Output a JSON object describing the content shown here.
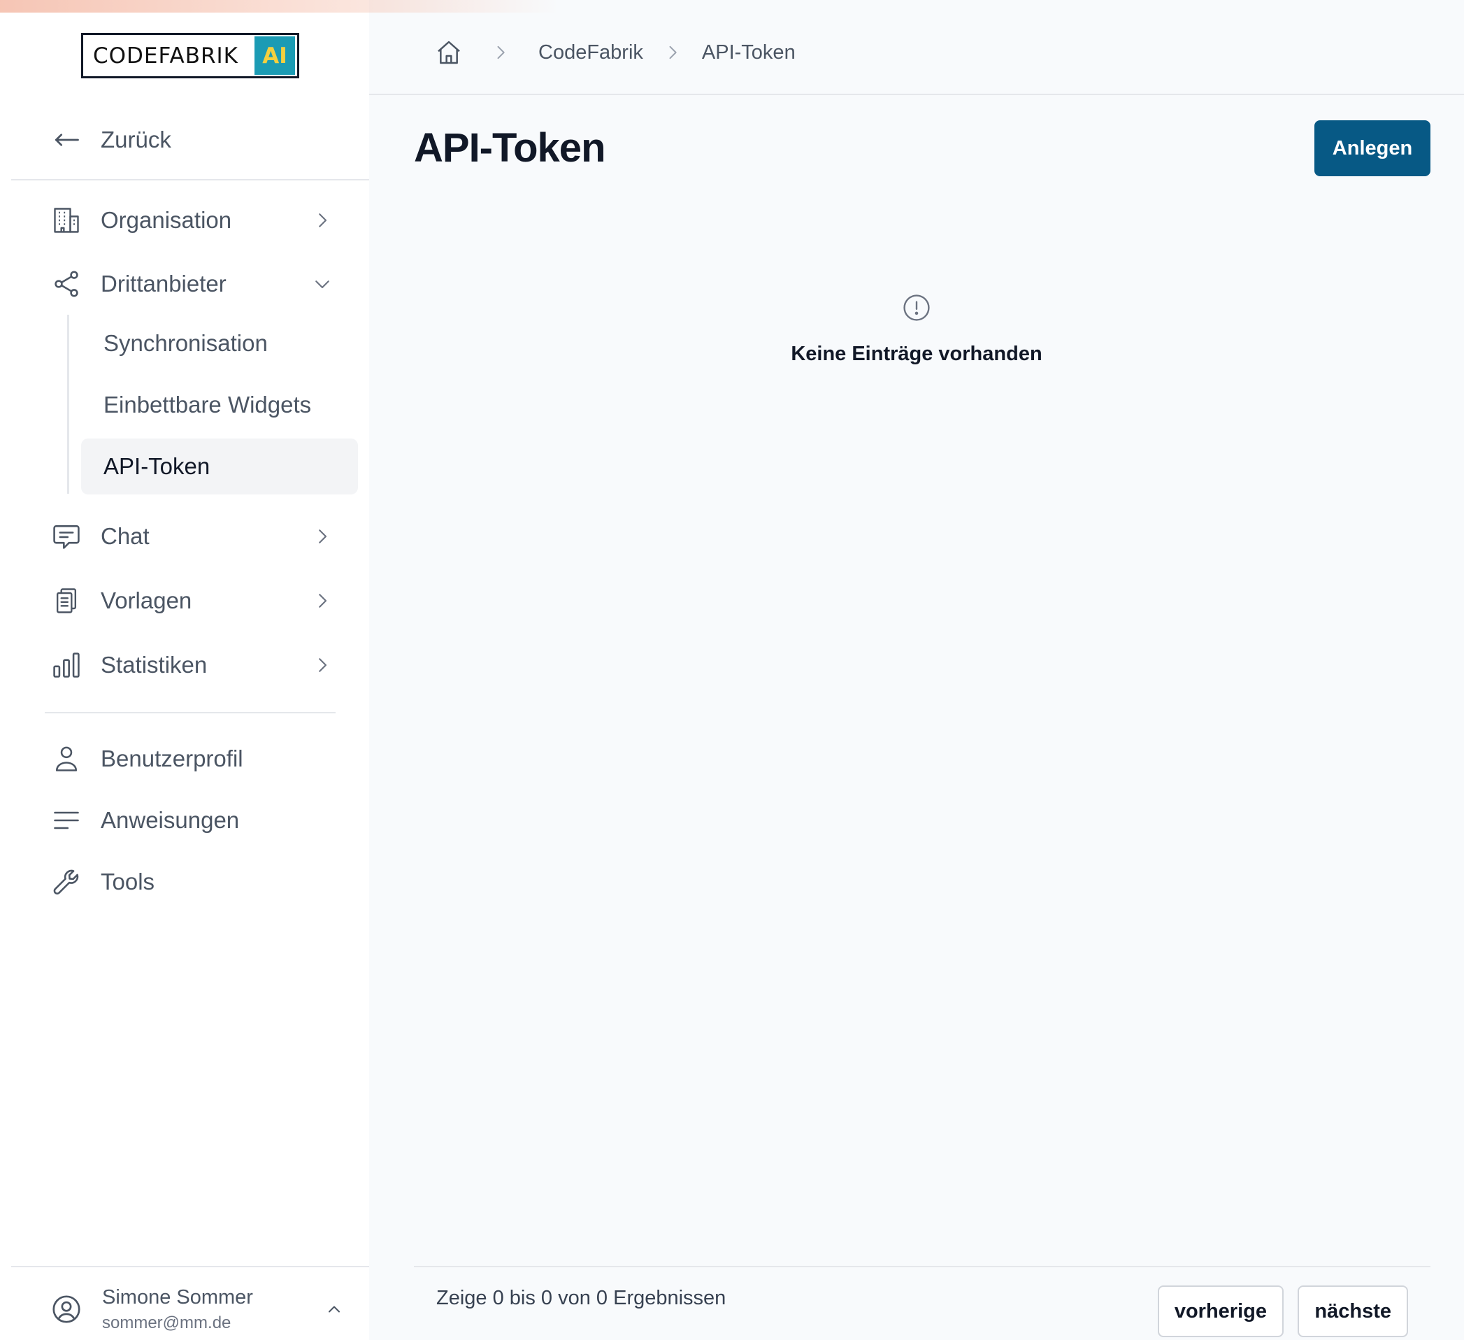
{
  "logo": {
    "text": "CODEFABRIK",
    "badge": "AI"
  },
  "sidebar": {
    "back_label": "Zurück",
    "items": [
      {
        "label": "Organisation",
        "icon": "building-icon"
      },
      {
        "label": "Drittanbieter",
        "icon": "share-icon"
      },
      {
        "label": "Chat",
        "icon": "chat-icon"
      },
      {
        "label": "Vorlagen",
        "icon": "clipboard-icon"
      },
      {
        "label": "Statistiken",
        "icon": "bar-chart-icon"
      }
    ],
    "subitems": [
      {
        "label": "Synchronisation"
      },
      {
        "label": "Einbettbare Widgets"
      },
      {
        "label": "API-Token",
        "active": true
      }
    ],
    "secondary": [
      {
        "label": "Benutzerprofil",
        "icon": "user-icon"
      },
      {
        "label": "Anweisungen",
        "icon": "lines-icon"
      },
      {
        "label": "Tools",
        "icon": "wrench-icon"
      }
    ],
    "user": {
      "name": "Simone Sommer",
      "email": "sommer@mm.de"
    }
  },
  "breadcrumb": {
    "items": [
      "CodeFabrik",
      "API-Token"
    ]
  },
  "main": {
    "title": "API-Token",
    "create_label": "Anlegen",
    "empty_text": "Keine Einträge vorhanden",
    "results_text": "Zeige 0 bis 0 von 0 Ergebnissen",
    "prev_label": "vorherige",
    "next_label": "nächste"
  },
  "colors": {
    "primary": "#075985",
    "logo_badge_bg": "#1b9bb4",
    "logo_badge_fg": "#f4d03f"
  }
}
